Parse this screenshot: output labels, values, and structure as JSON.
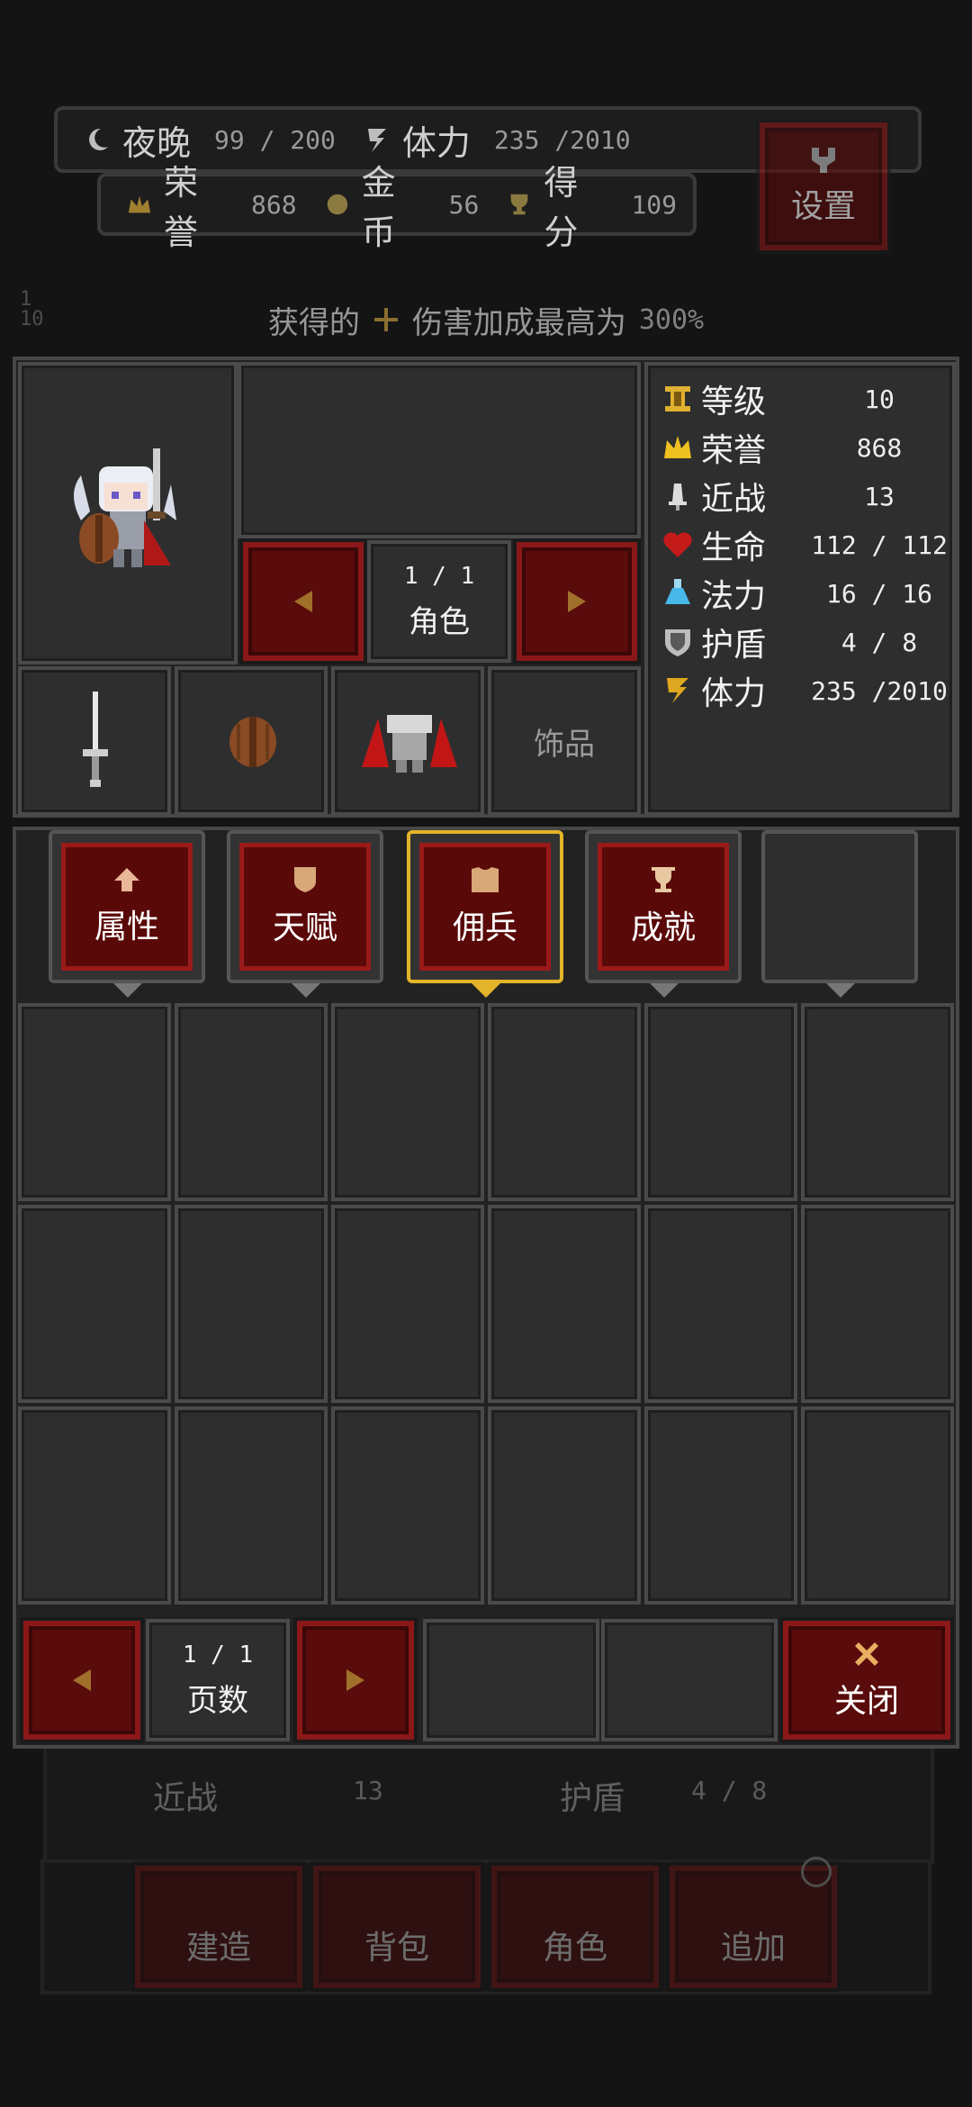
{
  "hud": {
    "night_label": "夜晚",
    "night_value": "99 / 200",
    "stamina_label": "体力",
    "stamina_value": "235 /2010",
    "honor_label": "荣誉",
    "honor_value": "868",
    "gold_label": "金币",
    "gold_value": "56",
    "score_label": "得分",
    "score_value": "109",
    "settings_label": "设置",
    "side_counter_top": "1",
    "side_counter_bottom": "10"
  },
  "banner": {
    "prefix": "获得的",
    "text": "伤害加成最高为",
    "value": "300%"
  },
  "character": {
    "page": "1  /  1",
    "page_label": "角色",
    "equipment": {
      "accessory_label": "饰品"
    }
  },
  "stats": [
    {
      "label": "等级",
      "value": "10",
      "icon": "level-icon",
      "color": "#e0b030"
    },
    {
      "label": "荣誉",
      "value": "868",
      "icon": "crown-icon",
      "color": "#f0c020"
    },
    {
      "label": "近战",
      "value": "13",
      "icon": "melee-icon",
      "color": "#dddddd"
    },
    {
      "label": "生命",
      "value": "112 / 112",
      "icon": "heart-icon",
      "color": "#c41a1a"
    },
    {
      "label": "法力",
      "value": "16  /  16",
      "icon": "potion-icon",
      "color": "#48b8e8"
    },
    {
      "label": "护盾",
      "value": "4  /  8",
      "icon": "shield-icon",
      "color": "#bdbdbd"
    },
    {
      "label": "体力",
      "value": "235 /2010",
      "icon": "stamina-icon",
      "color": "#e0a820"
    }
  ],
  "tabs": [
    {
      "label": "属性",
      "icon": "arrow-up-icon"
    },
    {
      "label": "天赋",
      "icon": "talent-icon"
    },
    {
      "label": "佣兵",
      "icon": "armor-icon"
    },
    {
      "label": "成就",
      "icon": "trophy-icon"
    }
  ],
  "active_tab": "佣兵",
  "pager": {
    "page": "1  /  1",
    "label": "页数"
  },
  "close_label": "关闭",
  "background": {
    "melee_label": "近战",
    "melee_value": "13",
    "shield_label": "护盾",
    "shield_value": "4  /  8",
    "bottom_nav": [
      "建造",
      "背包",
      "角色",
      "追加"
    ]
  }
}
